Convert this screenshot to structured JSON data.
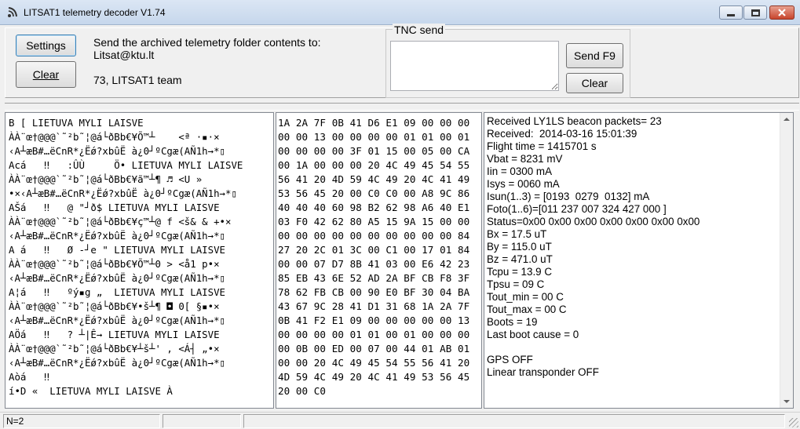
{
  "window": {
    "title": "LITSAT1 telemetry decoder V1.74",
    "icon": "satellite-dish-icon"
  },
  "toolbar": {
    "settings_label": "Settings",
    "clear_label": "Clear",
    "message_line1": "Send the archived telemetry folder contents to:",
    "message_line2": "Litsat@ktu.lt",
    "message_line3": "73, LITSAT1 team"
  },
  "tnc": {
    "caption": "TNC send",
    "input_value": "",
    "send_label": "Send F9",
    "clear_label": "Clear"
  },
  "panels": {
    "raw_text": [
      "B [ LIETUVA MYLI LAISVE",
      "ÀÀ¨œ†@@@`˜²b˜¦@á└ðBb€¥Õ™┴    <ª ·▪·×",
      "‹A┴æB#…ëCnR*¿Ëǿ?xbûË à¿0┘ºCgæ(AÑ1h→*▯",
      "Acá   ‼   :ÛÙ     Ö• LIETUVA MYLI LAISVE",
      "ÀÀ¨œ†@@@`˜²b˜¦@á└ðBb€¥ã™┴¶ ♬ <U »",
      "•×‹A┴æB#…ëCnR*¿Ëǿ?xbûË à¿0┘ºCgæ(AÑ1h→*▯",
      "AŠá   ‼   @ \"┘ð$ LIETUVA MYLI LAISVE",
      "ÀÀ¨œ†@@@`˜²b˜¦@á└ðBb€¥ç™┴@ f <š& & +•×",
      "‹A┴æB#…ëCnR*¿Ëǿ?xbûË à¿0┘ºCgæ(AÑ1h→*▯",
      "A á   ‼   Ø -┘e \" LIETUVA MYLI LAISVE",
      "ÀÀ¨œ†@@@`˜²b˜¦@á└ðBb€¥Õ™┴0 > <å1 p•×",
      "‹A┴æB#…ëCnR*¿Ëǿ?xbûË à¿0┘ºCgæ(AÑ1h→*▯",
      "A¦á   ‼   ºý▪g „  LIETUVA MYLI LAISVE",
      "ÀÀ¨œ†@@@`˜²b˜¦@á└ðBb€¥•š┴¶ ◘ 0[ §▪•×",
      "‹A┴æB#…ëCnR*¿Ëǿ?xbûË à¿0┘ºCgæ(AÑ1h→*▯",
      "AÖá   ‼   ? ┴|Ê→ LIETUVA MYLI LAISVE",
      "ÀÀ¨œ†@@@`˜²b˜¦@á└ðBb€¥┴š┴' , <Á┤ „•×",
      "‹A┴æB#…ëCnR*¿Ëǿ?xbûË à¿0┘ºCgæ(AÑ1h→*▯",
      "Aòá   ‼",
      "í•D «  LIETUVA MYLI LAISVE À"
    ],
    "hex_text": [
      "1A 2A 7F 0B 41 D6 E1 09 00 00 00",
      "00 00 13 00 00 00 00 01 01 00 01",
      "00 00 00 00 3F 01 15 00 05 00 CA",
      "00 1A 00 00 00 20 4C 49 45 54 55",
      "56 41 20 4D 59 4C 49 20 4C 41 49",
      "53 56 45 20 00 C0 C0 00 A8 9C 86",
      "40 40 40 60 98 B2 62 98 A6 40 E1",
      "03 F0 42 62 80 A5 15 9A 15 00 00",
      "00 00 00 00 00 00 00 00 00 00 84",
      "27 20 2C 01 3C 00 C1 00 17 01 84",
      "00 00 07 D7 8B 41 03 00 E6 42 23",
      "85 EB 43 6E 52 AD 2A BF CB F8 3F",
      "78 62 FB CB 00 90 E0 BF 30 04 BA",
      "43 67 9C 28 41 D1 31 68 1A 2A 7F",
      "0B 41 F2 E1 09 00 00 00 00 00 13",
      "00 00 00 00 01 01 00 01 00 00 00",
      "00 0B 00 ED 00 07 00 44 01 AB 01",
      "00 00 20 4C 49 45 54 55 56 41 20",
      "4D 59 4C 49 20 4C 41 49 53 56 45",
      "20 00 C0"
    ],
    "decoded_text": [
      "Received LY1LS beacon packets= 23",
      "Received:  2014-03-16 15:01:39",
      "Flight time = 1415701 s",
      "Vbat = 8231 mV",
      "Iin = 0300 mA",
      "Isys = 0060 mA",
      "Isun(1..3) = [0193  0279  0132] mA",
      "Foto(1..6)=[011 237 007 324 427 000 ]",
      "Status=0x00 0x00 0x00 0x00 0x00 0x00 0x00",
      "Bx = 17.5 uT",
      "By = 115.0 uT",
      "Bz = 471.0 uT",
      "Tcpu = 13.9 C",
      "Tpsu = 09 C",
      "Tout_min = 00 C",
      "Tout_max = 00 C",
      "Boots = 19",
      "Last boot cause = 0",
      "",
      "GPS OFF",
      "Linear transponder OFF"
    ]
  },
  "status": {
    "counter": "N=2"
  }
}
